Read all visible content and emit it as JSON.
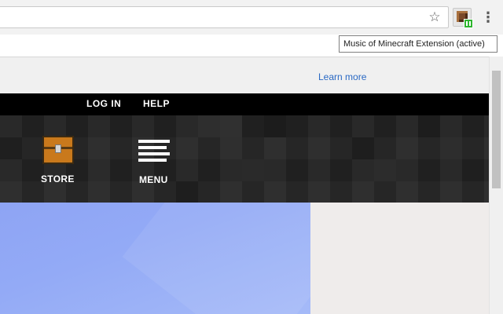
{
  "browser": {
    "tooltip": "Music of Minecraft Extension (active)",
    "icons": [
      "star-icon",
      "extension-icon",
      "more-menu-icon"
    ]
  },
  "banner": {
    "learn_more": "Learn more"
  },
  "topnav": {
    "login": "LOG IN",
    "help": "HELP"
  },
  "mainnav": {
    "store": "STORE",
    "menu": "MENU"
  },
  "colors": {
    "link": "#2a69c4",
    "nav_background": "#000000",
    "hero_sky": "#8ea4f4",
    "extension_badge": "#2fb52f"
  }
}
